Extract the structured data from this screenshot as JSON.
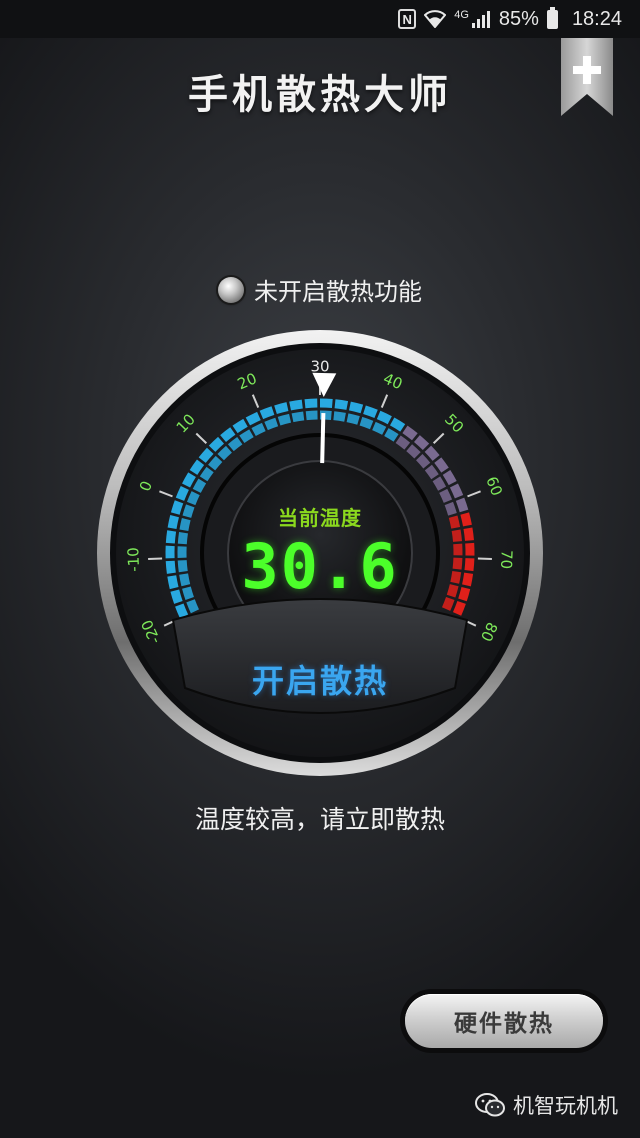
{
  "status_bar": {
    "network_label": "4G",
    "battery_percent": "85%",
    "time": "18:24",
    "icons": [
      "nfc-icon",
      "wifi-icon",
      "signal-icon",
      "battery-icon"
    ]
  },
  "header": {
    "title": "手机散热大师",
    "add_icon": "bookmark-add-icon"
  },
  "cooling_status": {
    "text": "未开启散热功能",
    "indicator": "led-off"
  },
  "gauge": {
    "label": "当前温度",
    "temperature": "30.6",
    "temperature_value": 30.6,
    "ticks": [
      "-20",
      "-10",
      "0",
      "10",
      "20",
      "30",
      "40",
      "50",
      "60",
      "70",
      "80"
    ],
    "min": -20,
    "max": 80,
    "colors": {
      "cool": "#29a9e0",
      "warm": "#7a6a90",
      "hot": "#e0201a",
      "digits": "#4cff2a",
      "label": "#8bd91e"
    },
    "start_button": "开启散热"
  },
  "tip": "温度较高，请立即散热",
  "hardware_button": "硬件散热",
  "watermark": "机智玩机机"
}
